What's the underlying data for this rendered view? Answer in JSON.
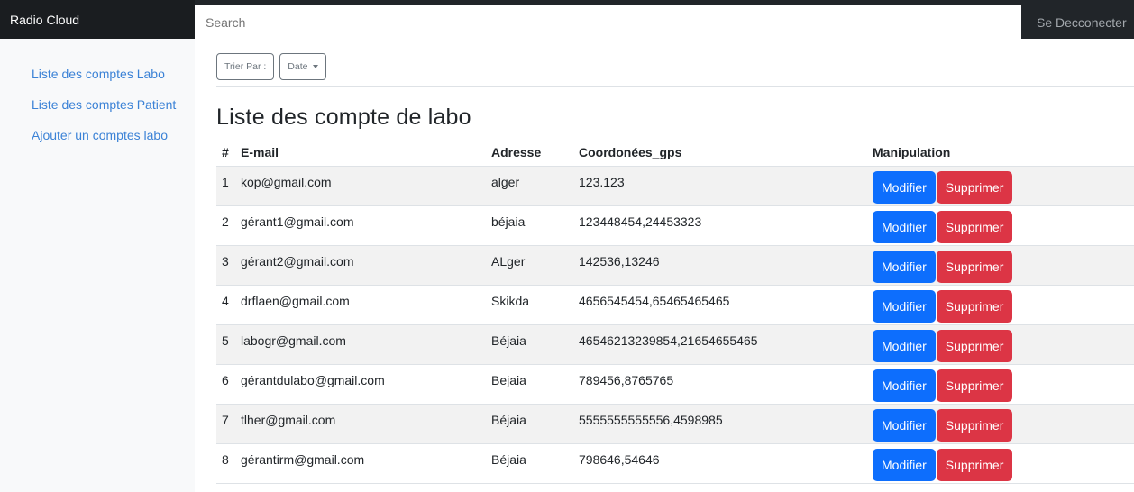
{
  "navbar": {
    "brand": "Radio Cloud",
    "search_placeholder": "Search",
    "logout": "Se Decconecter"
  },
  "sidebar": {
    "items": [
      {
        "label": "Liste des comptes Labo"
      },
      {
        "label": "Liste des comptes Patient"
      },
      {
        "label": "Ajouter un comptes labo"
      }
    ]
  },
  "toolbar": {
    "sort_label": "Trier Par :",
    "sort_value": "Date"
  },
  "page": {
    "title": "Liste des compte de labo"
  },
  "table": {
    "headers": {
      "num": "#",
      "email": "E-mail",
      "address": "Adresse",
      "gps": "Coordonées_gps",
      "actions": "Manipulation"
    },
    "edit_label": "Modifier",
    "delete_label": "Supprimer",
    "rows": [
      {
        "num": "1",
        "email": "kop@gmail.com",
        "address": "alger",
        "gps": "123.123"
      },
      {
        "num": "2",
        "email": "gérant1@gmail.com",
        "address": "béjaia",
        "gps": "123448454,24453323"
      },
      {
        "num": "3",
        "email": "gérant2@gmail.com",
        "address": "ALger",
        "gps": "142536,13246"
      },
      {
        "num": "4",
        "email": "drflaen@gmail.com",
        "address": "Skikda",
        "gps": "4656545454,65465465465"
      },
      {
        "num": "5",
        "email": "labogr@gmail.com",
        "address": "Béjaia",
        "gps": "46546213239854,21654655465"
      },
      {
        "num": "6",
        "email": "gérantdulabo@gmail.com",
        "address": "Bejaia",
        "gps": "789456,8765765"
      },
      {
        "num": "7",
        "email": "tlher@gmail.com",
        "address": "Béjaia",
        "gps": "5555555555556,4598985"
      },
      {
        "num": "8",
        "email": "gérantirm@gmail.com",
        "address": "Béjaia",
        "gps": "798646,54646"
      }
    ]
  },
  "colors": {
    "navbar_bg": "#212529",
    "link": "#3b82d6",
    "primary": "#0d6efd",
    "danger": "#dc3545"
  }
}
